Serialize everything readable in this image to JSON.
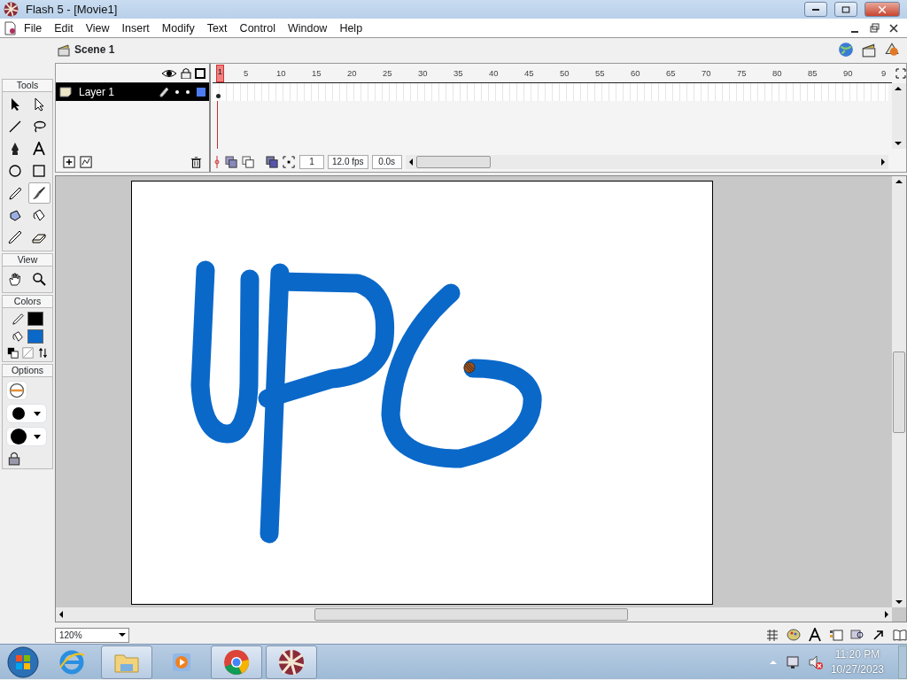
{
  "window": {
    "title": "Flash 5 - [Movie1]"
  },
  "menu": [
    "File",
    "Edit",
    "View",
    "Insert",
    "Modify",
    "Text",
    "Control",
    "Window",
    "Help"
  ],
  "scene": {
    "label": "Scene 1"
  },
  "ruler": [
    {
      "label": "1",
      "selected": true
    },
    {
      "label": "5",
      "selected": false
    },
    {
      "label": "10",
      "selected": false
    },
    {
      "label": "15",
      "selected": false
    },
    {
      "label": "20",
      "selected": false
    },
    {
      "label": "25",
      "selected": false
    },
    {
      "label": "30",
      "selected": false
    },
    {
      "label": "35",
      "selected": false
    },
    {
      "label": "40",
      "selected": false
    },
    {
      "label": "45",
      "selected": false
    },
    {
      "label": "50",
      "selected": false
    },
    {
      "label": "55",
      "selected": false
    },
    {
      "label": "60",
      "selected": false
    },
    {
      "label": "65",
      "selected": false
    },
    {
      "label": "70",
      "selected": false
    },
    {
      "label": "75",
      "selected": false
    },
    {
      "label": "80",
      "selected": false
    },
    {
      "label": "85",
      "selected": false
    },
    {
      "label": "90",
      "selected": false
    },
    {
      "label": "9",
      "selected": false
    }
  ],
  "layers": [
    {
      "name": "Layer 1",
      "selected": true
    }
  ],
  "timeline_status": {
    "frame": "1",
    "rate": "12.0 fps",
    "time": "0.0s"
  },
  "toolbox": [
    {
      "title": "Tools",
      "tools": [
        {
          "kind": "arrow",
          "selected": false
        },
        {
          "kind": "subselect",
          "selected": false
        },
        {
          "kind": "line",
          "selected": false
        },
        {
          "kind": "lasso",
          "selected": false
        },
        {
          "kind": "pen",
          "selected": false
        },
        {
          "kind": "text",
          "selected": false
        },
        {
          "kind": "oval",
          "selected": false
        },
        {
          "kind": "rect",
          "selected": false
        },
        {
          "kind": "pencil",
          "selected": false
        },
        {
          "kind": "brush",
          "selected": true
        },
        {
          "kind": "ink",
          "selected": false
        },
        {
          "kind": "bucket",
          "selected": false
        },
        {
          "kind": "dropper",
          "selected": false
        },
        {
          "kind": "eraser",
          "selected": false
        }
      ]
    },
    {
      "title": "View",
      "tools": [
        {
          "kind": "hand",
          "selected": false
        },
        {
          "kind": "zoom",
          "selected": false
        }
      ]
    }
  ],
  "colors": {
    "title": "Colors",
    "swatches": [
      {
        "kind": "stroke",
        "color": "#000000"
      },
      {
        "kind": "fill",
        "color": "#0a68c9"
      }
    ]
  },
  "options": {
    "title": "Options"
  },
  "zoom": {
    "value": "120%"
  },
  "taskbar": {
    "apps": [
      {
        "kind": "ie",
        "open": false
      },
      {
        "kind": "folder",
        "open": true
      },
      {
        "kind": "media",
        "open": false
      },
      {
        "kind": "chrome",
        "open": true
      },
      {
        "kind": "flash",
        "open": true
      }
    ],
    "time": "11:20 PM",
    "date": "10/27/2023"
  }
}
